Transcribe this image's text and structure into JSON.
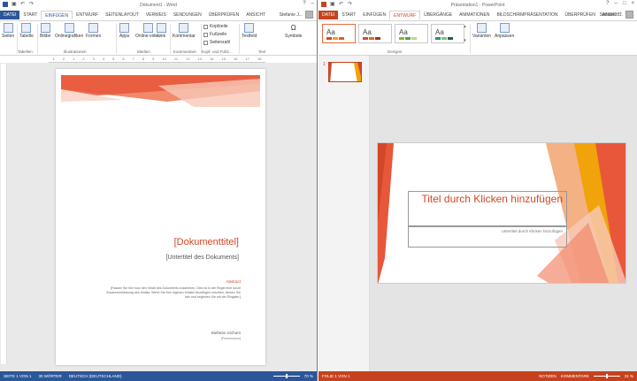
{
  "colors": {
    "word_blue": "#2b579a",
    "ppt_orange": "#c6421e",
    "accent": "#d24726"
  },
  "word": {
    "window_title": "Dokument1 - Word",
    "user": "Stefanie J...",
    "tabs": [
      "DATEI",
      "START",
      "EINFÜGEN",
      "ENTWURF",
      "SEITENLAYOUT",
      "VERWEIS",
      "SENDUNGEN",
      "ÜBERPRÜFEN",
      "ANSICHT"
    ],
    "ribbon": {
      "seiten": "Seiten",
      "tabelle": "Tabelle",
      "bilder": "Bilder",
      "onlinegrafiken": "Onlinegrafiken",
      "formen": "Formen",
      "apps": "Apps",
      "onlinevideo": "Online-video",
      "link": "Link",
      "kommentar": "Kommentar",
      "kopfzeile": "Kopfzeile",
      "fusszeile": "Fußzeile",
      "seitenzahl": "Seitenzahl",
      "textfeld": "Textfeld",
      "symbole": "Symbole",
      "groups": {
        "tabellen": "Tabellen",
        "illustrationen": "Illustrationen",
        "medien": "Medien",
        "kommentare": "Kommentare",
        "kopf_fuss": "Kopf- und Fußz...",
        "text": "Text"
      }
    },
    "ruler_ticks": [
      "1",
      "2",
      "1",
      "2",
      "3",
      "4",
      "5",
      "6",
      "7",
      "8",
      "9",
      "10",
      "11",
      "12",
      "13",
      "14",
      "15",
      "16",
      "17",
      "18"
    ],
    "document": {
      "title": "[Dokumenttitel]",
      "subtitle": "[Untertitel des Dokuments]",
      "abstract_heading": "Abstract",
      "abstract_text": "[Fassen Sie hier kurz den Inhalt des Dokuments zusammen. Dies ist in der Regel eine kurze Zusammenfassung des Inhalts. Wenn Sie Ihre eigenen Inhalte hinzufügen möchten, klicken Sie hier und beginnen Sie mit der Eingabe.]",
      "author": "Stefanie Jochum",
      "author_sub": "[Firmenname]"
    },
    "status": {
      "page": "SEITE 1 VON 1",
      "words": "30 WÖRTER",
      "language": "DEUTSCH (DEUTSCHLAND)",
      "zoom": "70 %"
    }
  },
  "ppt": {
    "window_title": "Präsentation1 - PowerPoint",
    "user": "Stefanie J...",
    "tabs": [
      "DATEI",
      "START",
      "EINFÜGEN",
      "ENTWURF",
      "ÜBERGÄNGE",
      "ANIMATIONEN",
      "BILDSCHIRMPRÄSENTATION",
      "ÜBERPRÜFEN",
      "ANSICHT"
    ],
    "design_label": "Aa",
    "design_group": "Designs",
    "varianten": "Varianten",
    "anpassen": "Anpassen",
    "slide_number": "1",
    "slide": {
      "title": "Titel durch Klicken hinzufügen",
      "subtitle": "Untertitel durch Klicken hinzufügen"
    },
    "status": {
      "slide": "FOLIE 1 VON 1",
      "notes": "NOTIZEN",
      "comments": "KOMMENTARE",
      "zoom": "31 %"
    }
  }
}
